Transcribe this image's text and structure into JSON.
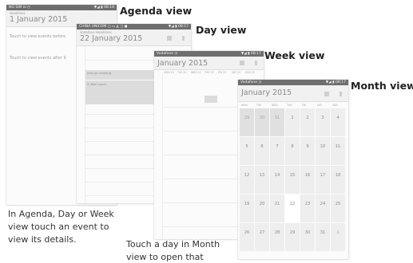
{
  "titles": {
    "agenda": "Agenda view",
    "day": "Day view",
    "week": "Week view",
    "month": "Month view"
  },
  "agenda_screen": {
    "status_left": "NO SIM ⊡ ◷",
    "status_right": "▼◢ ▮ 08:18",
    "header_small": "Headlines",
    "header_date": "1 January 2015",
    "line1": "Touch to view events before",
    "line2": "Touch to view events after 9"
  },
  "day_screen": {
    "status_left": "CHINA UNICOM ◻ ▭ ◭ ◻ ◼",
    "status_right": "▼◢ ▮ 08:17",
    "header_small": "Vodafone Headlines",
    "header_date": "22 January 2015",
    "event1": "Annual meeting",
    "event2": "A little lunch"
  },
  "week_screen": {
    "status_left": "Vodafone ◷",
    "status_right": "▼◢ ▮ 08:17",
    "header_date": "January 2015",
    "days": [
      "MON 19",
      "TUE 20",
      "WED 21",
      "THU 22",
      "FRI 23",
      "SAT 24",
      "SUN 25"
    ]
  },
  "month_screen": {
    "status_left": "Vodafone ◷",
    "status_right": "▼◢ ▮ 08:17",
    "header_date": "January 2015",
    "weekdays": [
      "MON",
      "TUE",
      "WED",
      "THU",
      "FRI",
      "SAT",
      "SUN"
    ],
    "weeks": [
      [
        "29",
        "30",
        "31",
        "1",
        "2",
        "3",
        "4"
      ],
      [
        "5",
        "6",
        "7",
        "8",
        "9",
        "10",
        "11"
      ],
      [
        "12",
        "13",
        "14",
        "15",
        "16",
        "17",
        "18"
      ],
      [
        "19",
        "20",
        "21",
        "22",
        "23",
        "24",
        "25"
      ],
      [
        "26",
        "27",
        "28",
        "29",
        "30",
        "31",
        "1"
      ]
    ],
    "today": "22"
  },
  "captions": {
    "left": [
      "In Agenda, Day or Week",
      "view touch an event to",
      "view its details."
    ],
    "right": [
      "Touch a day in Month",
      "view to open that"
    ]
  }
}
